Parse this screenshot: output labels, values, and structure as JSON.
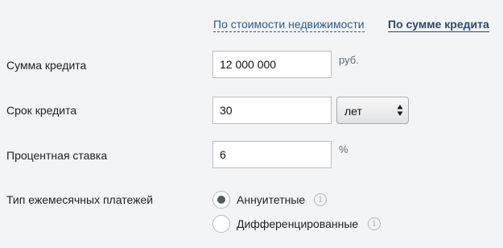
{
  "tabs": {
    "by_property_cost": "По стоимости недвижимости",
    "by_loan_amount": "По сумме кредита"
  },
  "loan_amount": {
    "label": "Сумма кредита",
    "value": "12 000 000",
    "unit": "руб."
  },
  "loan_term": {
    "label": "Срок кредита",
    "value": "30",
    "unit_selected": "лет"
  },
  "interest_rate": {
    "label": "Процентная ставка",
    "value": "6",
    "unit": "%"
  },
  "payment_type": {
    "label": "Тип ежемесячных платежей",
    "options": [
      {
        "label": "Аннуитетные",
        "selected": true
      },
      {
        "label": "Дифференцированные",
        "selected": false
      }
    ],
    "info_glyph": "i"
  },
  "icons": {
    "info": "info-icon",
    "select_arrows": "updown-arrows-icon"
  },
  "colors": {
    "background": "#f3f4f6",
    "link": "#2f5b8a",
    "active_tab": "#2c4a6b",
    "radio_dot": "#4e5a66"
  }
}
